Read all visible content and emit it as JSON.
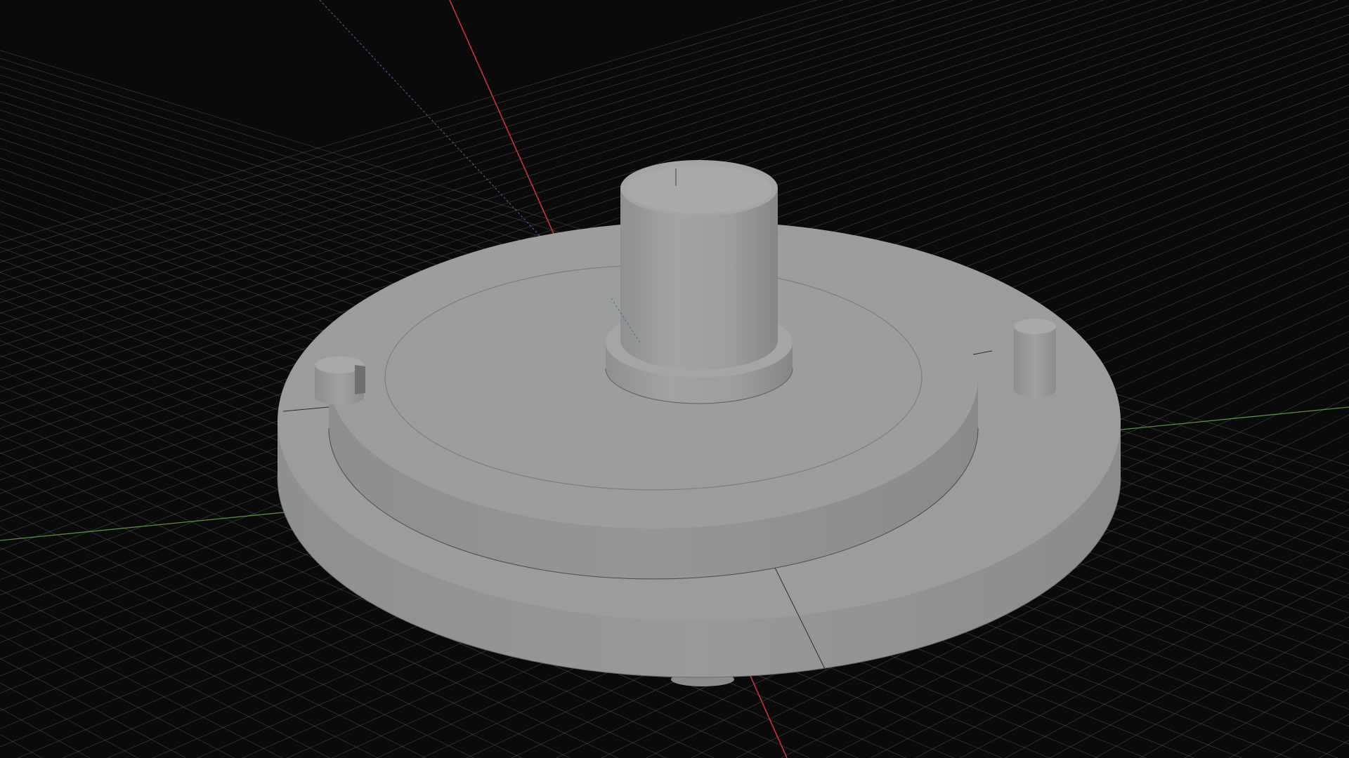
{
  "viewport": {
    "background": "#0a0a0a",
    "grid_color": "#5a5a5a",
    "axis_x_color": "#c8323c",
    "axis_y_color": "#5a8c3c",
    "axis_z_color": "#4a6aa8",
    "model_color": "#9a9b9b"
  },
  "scene": {
    "model_name": "cylindrical-base-with-peg",
    "parts": [
      "base-flange",
      "raised-disc",
      "center-boss",
      "boss-collar",
      "pin-left",
      "pin-right",
      "mounting-stub"
    ]
  }
}
